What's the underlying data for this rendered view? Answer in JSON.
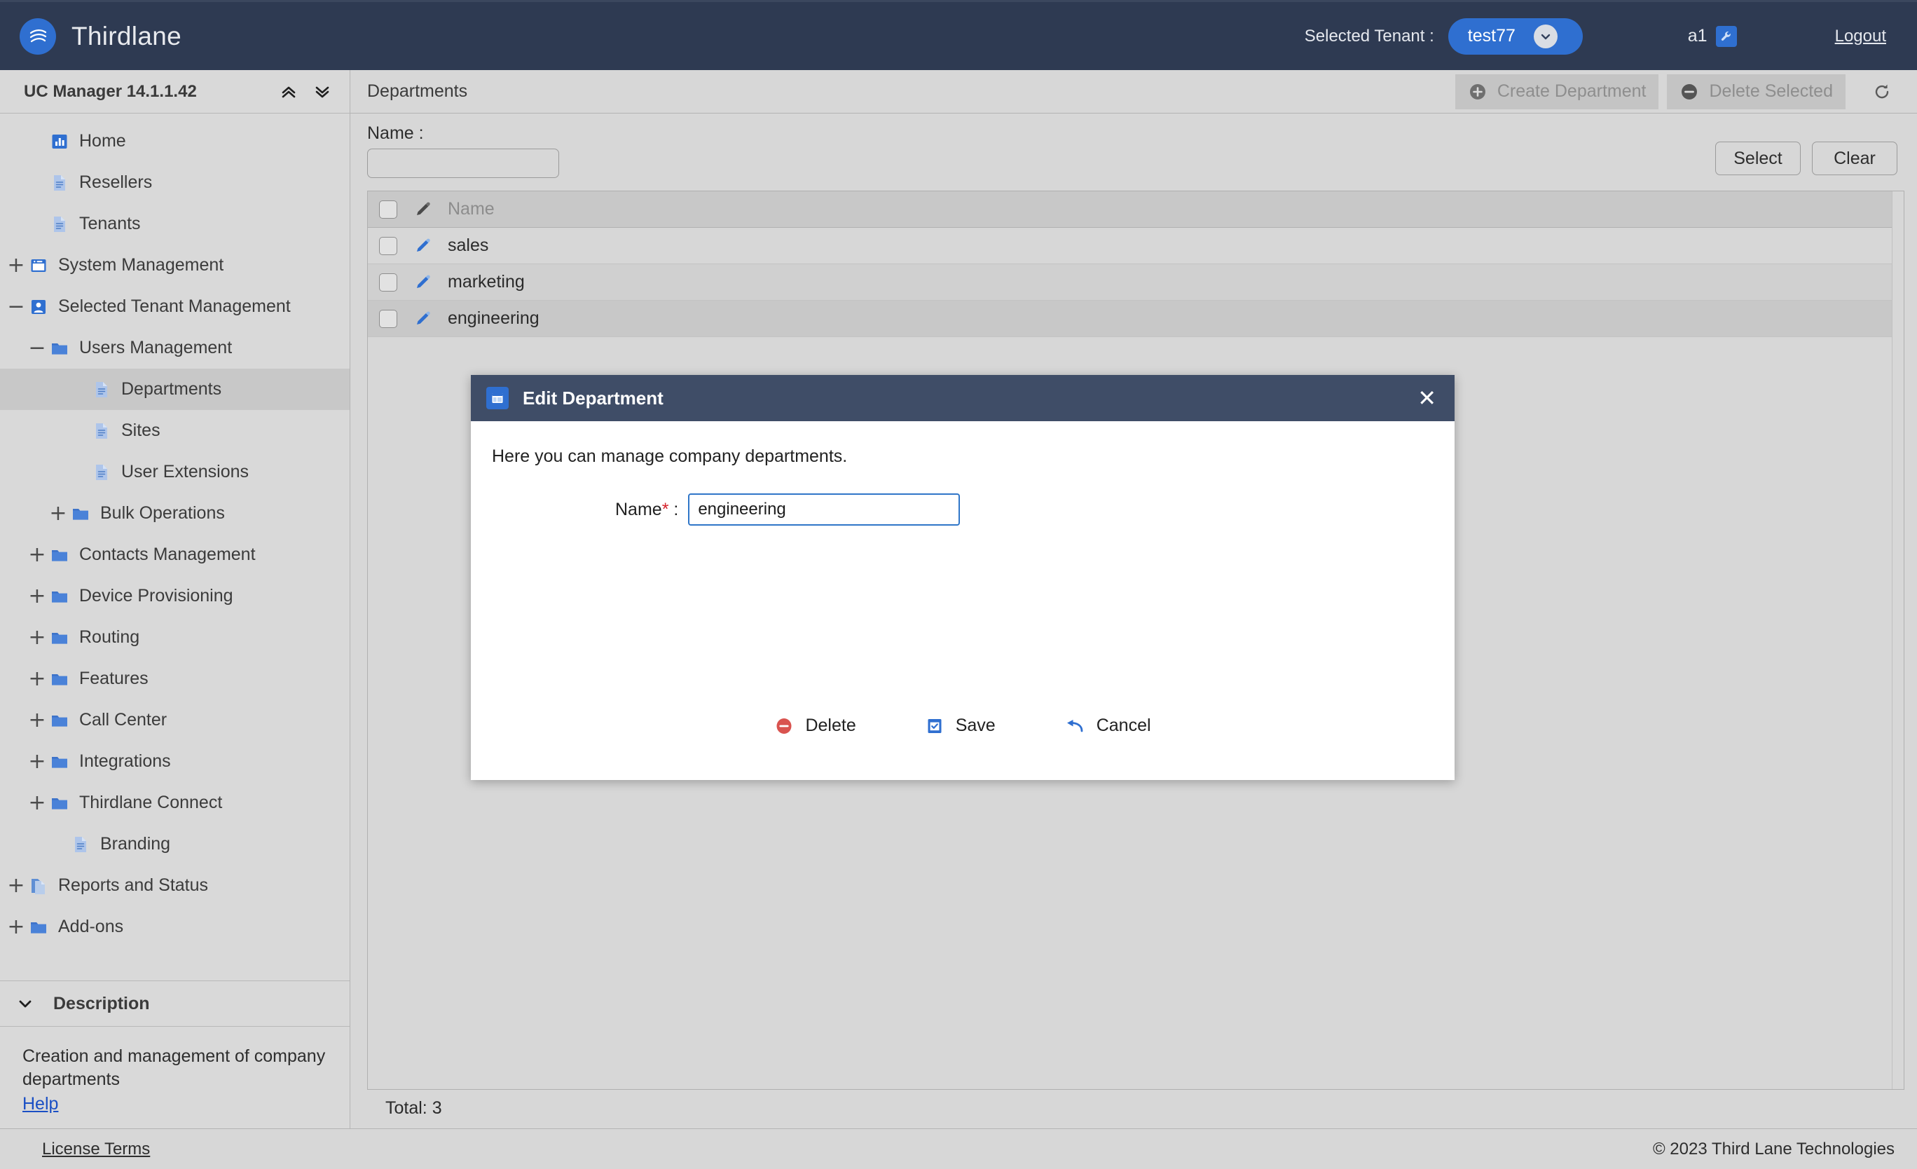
{
  "header": {
    "brand_name": "Thirdlane",
    "brand_logo_icon": "thirdlane-waves-logo",
    "tenant_label": "Selected Tenant :",
    "tenant_value": "test77",
    "tenant_caret_icon": "chevron-down-icon",
    "user_name": "a1",
    "user_badge_icon": "wrench-icon",
    "logout_label": "Logout",
    "accent_color": "#2f6fd0",
    "bar_color": "#2e3a52"
  },
  "sidebar": {
    "title": "UC Manager 14.1.1.42",
    "collapse_all_icon": "chevrons-up-icon",
    "expand_all_icon": "chevrons-down-icon",
    "items": [
      {
        "label": "Home",
        "icon": "chart-icon",
        "toggle": "",
        "indent": 1,
        "selected": false
      },
      {
        "label": "Resellers",
        "icon": "document-icon",
        "toggle": "",
        "indent": 1,
        "selected": false
      },
      {
        "label": "Tenants",
        "icon": "document-icon",
        "toggle": "",
        "indent": 1,
        "selected": false
      },
      {
        "label": "System Management",
        "icon": "window-icon",
        "toggle": "+",
        "indent": 0,
        "selected": false
      },
      {
        "label": "Selected Tenant Management",
        "icon": "user-icon",
        "toggle": "-",
        "indent": 0,
        "selected": false
      },
      {
        "label": "Users Management",
        "icon": "folder-icon",
        "toggle": "-",
        "indent": 1,
        "selected": false
      },
      {
        "label": "Departments",
        "icon": "document-icon",
        "toggle": "",
        "indent": 3,
        "selected": true
      },
      {
        "label": "Sites",
        "icon": "document-icon",
        "toggle": "",
        "indent": 3,
        "selected": false
      },
      {
        "label": "User Extensions",
        "icon": "document-icon",
        "toggle": "",
        "indent": 3,
        "selected": false
      },
      {
        "label": "Bulk Operations",
        "icon": "folder-icon",
        "toggle": "+",
        "indent": 2,
        "selected": false
      },
      {
        "label": "Contacts Management",
        "icon": "folder-icon",
        "toggle": "+",
        "indent": 1,
        "selected": false
      },
      {
        "label": "Device Provisioning",
        "icon": "folder-icon",
        "toggle": "+",
        "indent": 1,
        "selected": false
      },
      {
        "label": "Routing",
        "icon": "folder-icon",
        "toggle": "+",
        "indent": 1,
        "selected": false
      },
      {
        "label": "Features",
        "icon": "folder-icon",
        "toggle": "+",
        "indent": 1,
        "selected": false
      },
      {
        "label": "Call Center",
        "icon": "folder-icon",
        "toggle": "+",
        "indent": 1,
        "selected": false
      },
      {
        "label": "Integrations",
        "icon": "folder-icon",
        "toggle": "+",
        "indent": 1,
        "selected": false
      },
      {
        "label": "Thirdlane Connect",
        "icon": "folder-icon",
        "toggle": "+",
        "indent": 1,
        "selected": false
      },
      {
        "label": "Branding",
        "icon": "document-icon",
        "toggle": "",
        "indent": 2,
        "selected": false
      },
      {
        "label": "Reports and Status",
        "icon": "pages-icon",
        "toggle": "+",
        "indent": 0,
        "selected": false
      },
      {
        "label": "Add-ons",
        "icon": "folder-icon",
        "toggle": "+",
        "indent": 0,
        "selected": false
      }
    ],
    "description": {
      "header_label": "Description",
      "header_icon": "chevron-down-icon",
      "text": "Creation and management of company departments",
      "help_label": "Help"
    }
  },
  "main": {
    "page_title": "Departments",
    "toolbar": {
      "create_label": "Create Department",
      "create_icon": "plus-circle-icon",
      "delete_label": "Delete Selected",
      "delete_icon": "minus-circle-icon",
      "refresh_icon": "refresh-icon"
    },
    "filter": {
      "name_label": "Name :",
      "name_value": "",
      "name_placeholder": "",
      "select_label": "Select",
      "clear_label": "Clear"
    },
    "table": {
      "columns": [
        "Name"
      ],
      "header_check_icon": "checkbox-icon",
      "header_edit_icon": "pencil-icon",
      "rows": [
        {
          "name": "sales",
          "checked": false,
          "edit_icon": "pencil-icon"
        },
        {
          "name": "marketing",
          "checked": false,
          "edit_icon": "pencil-icon"
        },
        {
          "name": "engineering",
          "checked": false,
          "edit_icon": "pencil-icon"
        }
      ]
    },
    "total_label": "Total: 3"
  },
  "modal": {
    "title": "Edit Department",
    "title_icon": "window-panel-icon",
    "close_icon": "close-icon",
    "description": "Here you can manage company departments.",
    "field_label": "Name",
    "field_required_mark": "*",
    "field_colon": ":",
    "field_value": "engineering",
    "field_placeholder": "",
    "buttons": [
      {
        "label": "Delete",
        "icon": "minus-circle-icon",
        "color": "#d9534f"
      },
      {
        "label": "Save",
        "icon": "save-checkbox-icon",
        "color": "#2f6fd0"
      },
      {
        "label": "Cancel",
        "icon": "undo-arrow-icon",
        "color": "#2f6fd0"
      }
    ]
  },
  "footer": {
    "license_label": "License Terms",
    "copyright": "© 2023 Third Lane Technologies"
  }
}
